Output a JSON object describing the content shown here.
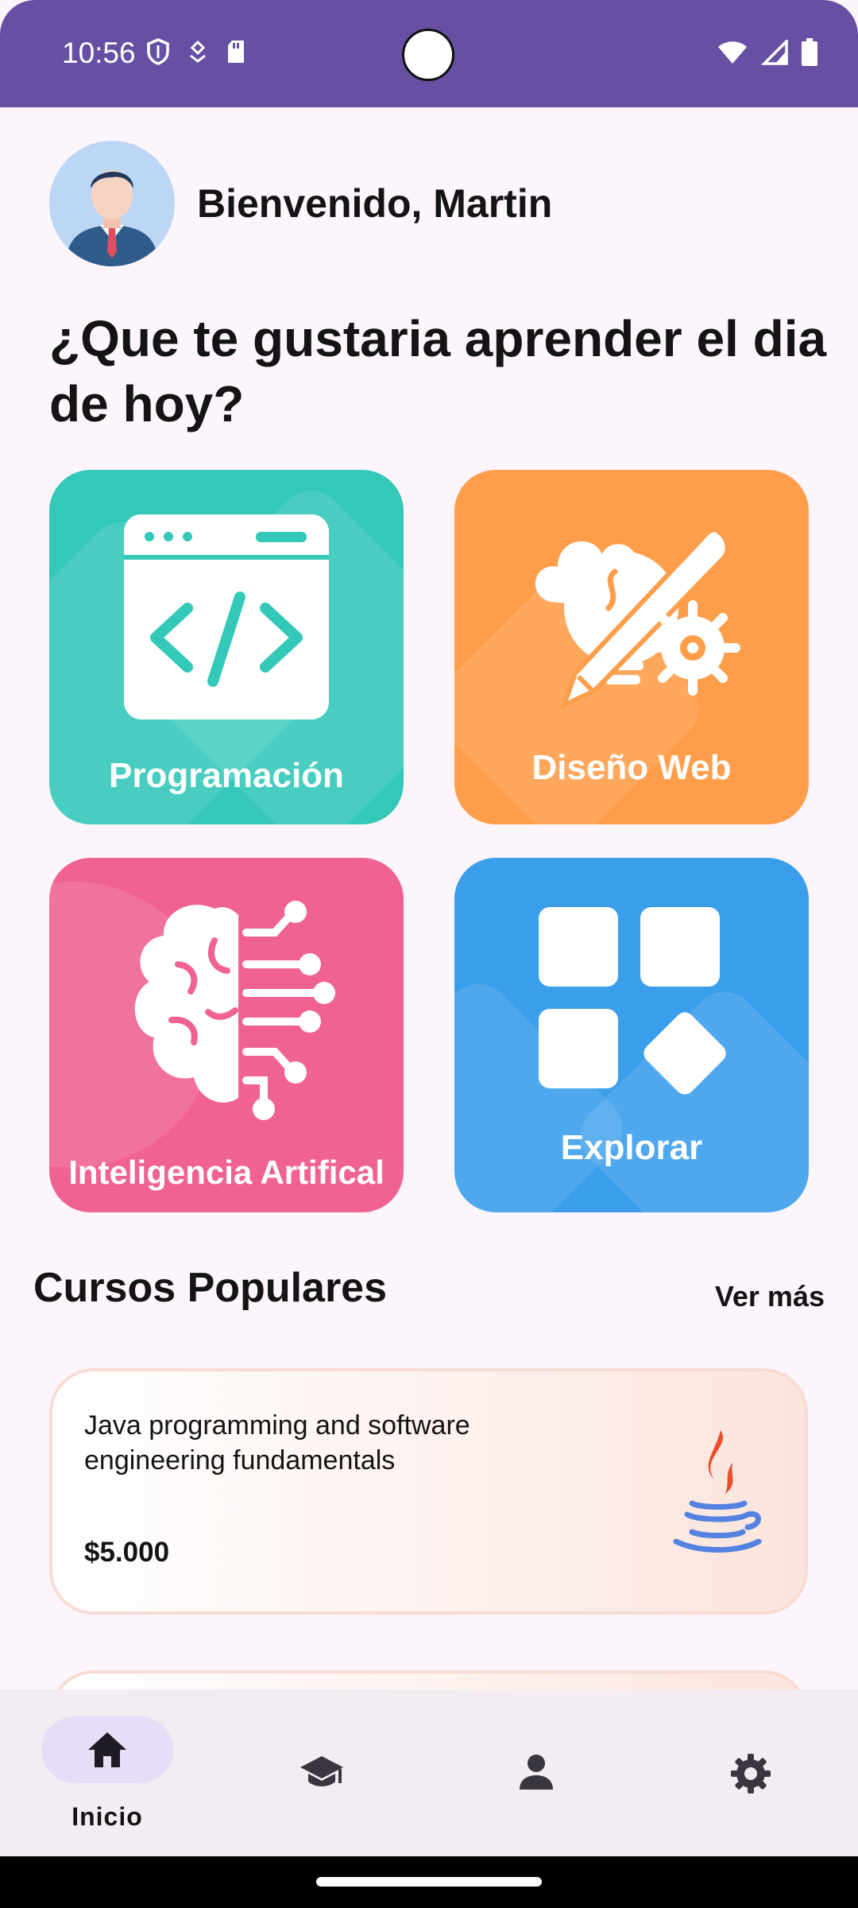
{
  "status_bar": {
    "time": "10:56",
    "color": "#6750A4"
  },
  "header": {
    "welcome": "Bienvenido, Martin",
    "question": "¿Que te gustaria aprender el dia de hoy?"
  },
  "categories": [
    {
      "label": "Programación",
      "color": "#34C8B9",
      "icon": "code-window-icon"
    },
    {
      "label": "Diseño Web",
      "color": "#FF9E4A",
      "icon": "design-tools-icon"
    },
    {
      "label": "Inteligencia Artifical",
      "color": "#F06292",
      "icon": "ai-brain-icon"
    },
    {
      "label": "Explorar",
      "color": "#3B9EEB",
      "icon": "apps-grid-icon"
    }
  ],
  "popular": {
    "title": "Cursos Populares",
    "see_more": "Ver más",
    "courses": [
      {
        "title": "Java programming and software engineering fundamentals",
        "price": "$5.000",
        "icon": "java-logo-icon"
      }
    ]
  },
  "bottom_nav": {
    "items": [
      {
        "label": "Inicio",
        "icon": "home-icon",
        "active": true
      },
      {
        "label": "",
        "icon": "school-icon",
        "active": false
      },
      {
        "label": "",
        "icon": "person-icon",
        "active": false
      },
      {
        "label": "",
        "icon": "settings-icon",
        "active": false
      }
    ],
    "active_color": "#E8DDF7"
  }
}
